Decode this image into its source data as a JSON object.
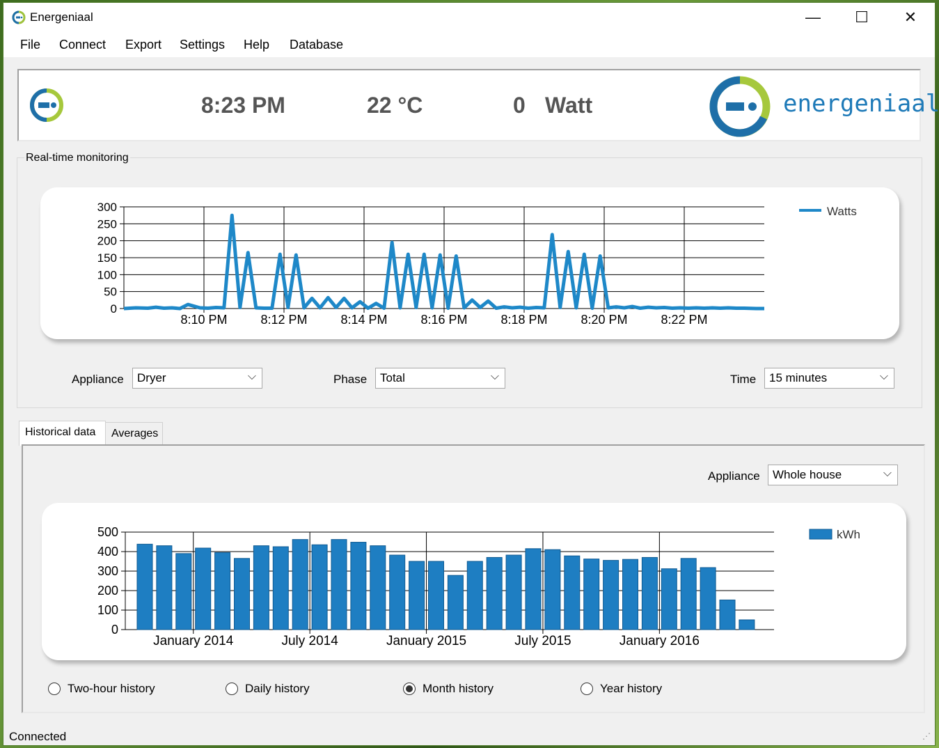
{
  "window": {
    "title": "Energeniaal"
  },
  "window_controls": {
    "minimize": "—",
    "maximize": "☐",
    "close": "✕"
  },
  "menu": [
    "File",
    "Connect",
    "Export",
    "Settings",
    "Help",
    "Database"
  ],
  "header": {
    "time": "8:23 PM",
    "temperature": "22 °C",
    "power_value": "0",
    "power_unit": "Watt",
    "brand": "energeniaal"
  },
  "realtime": {
    "group_label": "Real-time monitoring",
    "appliance_label": "Appliance",
    "appliance_value": "Dryer",
    "phase_label": "Phase",
    "phase_value": "Total",
    "time_label": "Time",
    "time_value": "15 minutes"
  },
  "tabs": [
    "Historical data",
    "Averages"
  ],
  "historical": {
    "appliance_label": "Appliance",
    "appliance_value": "Whole house",
    "radios": [
      "Two-hour history",
      "Daily history",
      "Month history",
      "Year history"
    ],
    "selected_radio": 2
  },
  "status": {
    "text": "Connected"
  },
  "chart_data": [
    {
      "type": "line",
      "series": [
        {
          "name": "Watts",
          "color": "#1e88c8"
        }
      ],
      "x_tick_labels": [
        "8:10 PM",
        "8:12 PM",
        "8:14 PM",
        "8:16 PM",
        "8:18 PM",
        "8:20 PM",
        "8:22 PM"
      ],
      "ylim": [
        0,
        300
      ],
      "y_ticks": [
        0,
        50,
        100,
        150,
        200,
        250,
        300
      ],
      "x_unit": "minutes after 8:00 PM",
      "x": [
        8.0,
        8.3,
        8.6,
        8.8,
        9.0,
        9.2,
        9.4,
        9.6,
        9.9,
        10.1,
        10.3,
        10.5,
        10.7,
        10.9,
        11.1,
        11.3,
        11.5,
        11.7,
        11.9,
        12.1,
        12.3,
        12.5,
        12.7,
        12.9,
        13.1,
        13.3,
        13.5,
        13.7,
        13.9,
        14.1,
        14.3,
        14.5,
        14.7,
        14.9,
        15.1,
        15.3,
        15.5,
        15.7,
        15.9,
        16.1,
        16.3,
        16.5,
        16.7,
        16.9,
        17.1,
        17.3,
        17.5,
        17.7,
        17.9,
        18.1,
        18.3,
        18.5,
        18.7,
        18.9,
        19.1,
        19.3,
        19.5,
        19.7,
        19.9,
        20.1,
        20.3,
        20.5,
        20.7,
        20.9,
        21.1,
        21.3,
        21.5,
        21.7,
        21.9,
        22.1,
        22.3,
        22.5,
        22.7,
        22.9,
        23.1,
        23.3,
        23.5,
        23.8,
        24.0
      ],
      "values": [
        0,
        2,
        1,
        4,
        1,
        2,
        0,
        12,
        2,
        1,
        3,
        2,
        275,
        3,
        165,
        2,
        1,
        1,
        160,
        3,
        158,
        2,
        30,
        2,
        32,
        3,
        30,
        2,
        20,
        1,
        15,
        1,
        195,
        2,
        160,
        3,
        160,
        2,
        158,
        1,
        155,
        2,
        25,
        3,
        22,
        1,
        5,
        2,
        4,
        1,
        3,
        2,
        218,
        3,
        168,
        2,
        160,
        1,
        155,
        2,
        5,
        2,
        6,
        1,
        4,
        2,
        3,
        1,
        2,
        1,
        2,
        1,
        2,
        1,
        2,
        1,
        1,
        0,
        0
      ]
    },
    {
      "type": "bar",
      "series": [
        {
          "name": "kWh",
          "color": "#1e7ec2"
        }
      ],
      "x_tick_labels": [
        "January 2014",
        "July 2014",
        "January 2015",
        "July 2015",
        "January 2016"
      ],
      "ylim": [
        0,
        500
      ],
      "y_ticks": [
        0,
        100,
        200,
        300,
        400,
        500
      ],
      "values": [
        438,
        430,
        390,
        418,
        395,
        365,
        430,
        425,
        462,
        435,
        462,
        448,
        430,
        382,
        350,
        350,
        278,
        350,
        370,
        382,
        415,
        410,
        378,
        362,
        355,
        360,
        370,
        312,
        365,
        318,
        152,
        50
      ]
    }
  ]
}
